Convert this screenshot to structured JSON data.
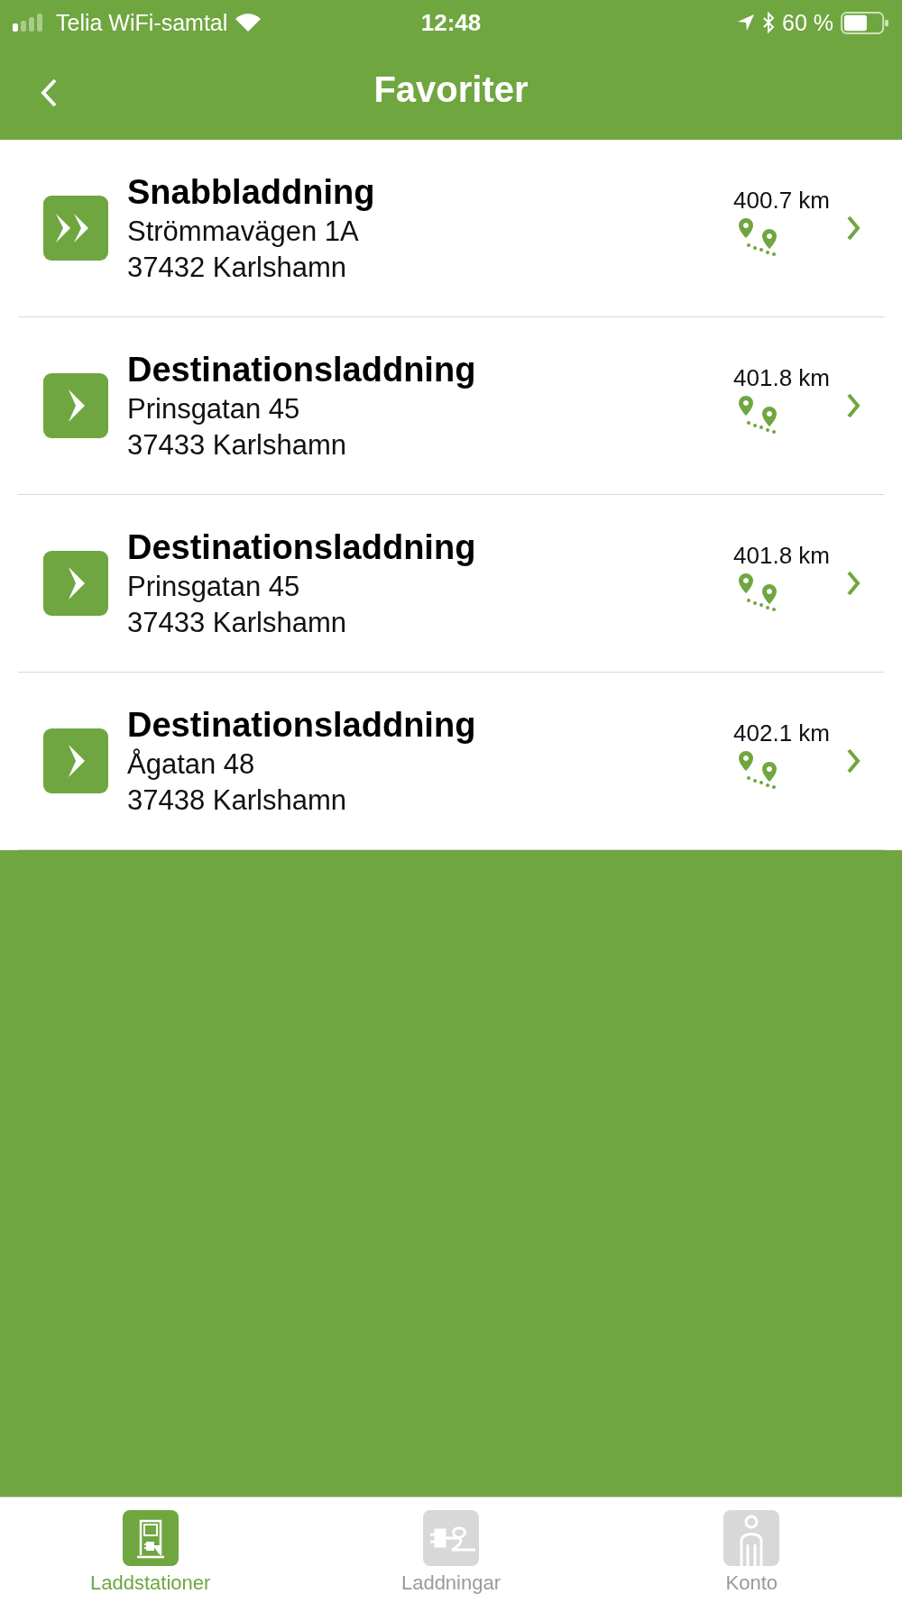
{
  "status_bar": {
    "carrier": "Telia WiFi-samtal",
    "time": "12:48",
    "battery": "60 %"
  },
  "nav": {
    "title": "Favoriter"
  },
  "favorites": [
    {
      "kind": "fast",
      "title": "Snabbladdning",
      "street": "Strömmavägen 1A",
      "city": "37432 Karlshamn",
      "distance": "400.7 km"
    },
    {
      "kind": "destination",
      "title": "Destinationsladdning",
      "street": "Prinsgatan 45",
      "city": "37433 Karlshamn",
      "distance": "401.8 km"
    },
    {
      "kind": "destination",
      "title": "Destinationsladdning",
      "street": "Prinsgatan 45",
      "city": "37433 Karlshamn",
      "distance": "401.8 km"
    },
    {
      "kind": "destination",
      "title": "Destinationsladdning",
      "street": "Ågatan 48",
      "city": "37438 Karlshamn",
      "distance": "402.1 km"
    }
  ],
  "tabs": [
    {
      "kind": "stations",
      "label": "Laddstationer",
      "selected": true
    },
    {
      "kind": "charges",
      "label": "Laddningar",
      "selected": false
    },
    {
      "kind": "account",
      "label": "Konto",
      "selected": false
    }
  ]
}
